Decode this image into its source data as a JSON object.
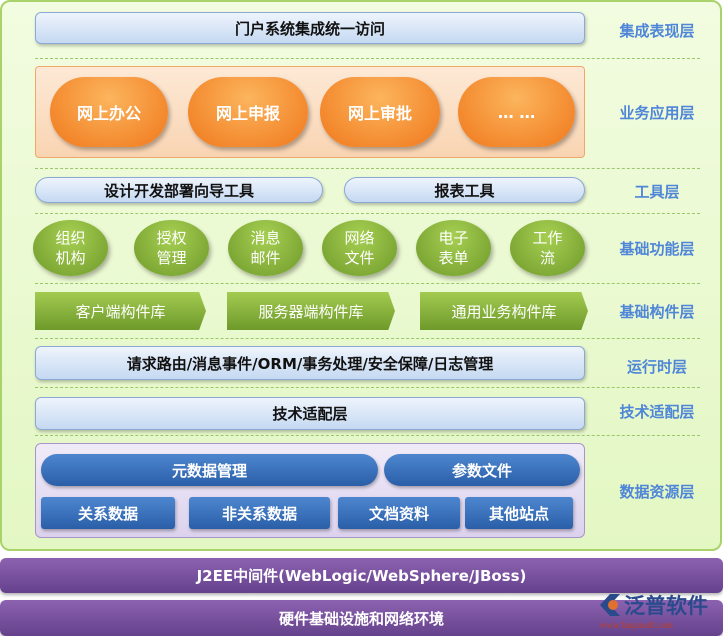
{
  "layers": {
    "presentation": {
      "label": "集成表现层",
      "portal": "门户系统集成统一访问"
    },
    "application": {
      "label": "业务应用层",
      "items": [
        "网上办公",
        "网上申报",
        "网上审批",
        "… …"
      ]
    },
    "tools": {
      "label": "工具层",
      "items": [
        "设计开发部署向导工具",
        "报表工具"
      ]
    },
    "functions": {
      "label": "基础功能层",
      "items": [
        [
          "组织",
          "机构"
        ],
        [
          "授权",
          "管理"
        ],
        [
          "消息",
          "邮件"
        ],
        [
          "网络",
          "文件"
        ],
        [
          "电子",
          "表单"
        ],
        [
          "工作",
          "流"
        ]
      ]
    },
    "components": {
      "label": "基础构件层",
      "items": [
        "客户端构件库",
        "服务器端构件库",
        "通用业务构件库"
      ]
    },
    "runtime": {
      "label": "运行时层",
      "text": "请求路由/消息事件/ORM/事务处理/安全保障/日志管理"
    },
    "adapter": {
      "label": "技术适配层",
      "text": "技术适配层"
    },
    "data": {
      "label": "数据资源层",
      "top": [
        "元数据管理",
        "参数文件"
      ],
      "bottom": [
        "关系数据",
        "非关系数据",
        "文档资料",
        "其他站点"
      ]
    }
  },
  "middleware": "J2EE中间件(WebLogic/WebSphere/JBoss)",
  "hardware": "硬件基础设施和网络环境",
  "logo": {
    "name": "泛普软件",
    "url": "www.fanpusoft.com"
  }
}
